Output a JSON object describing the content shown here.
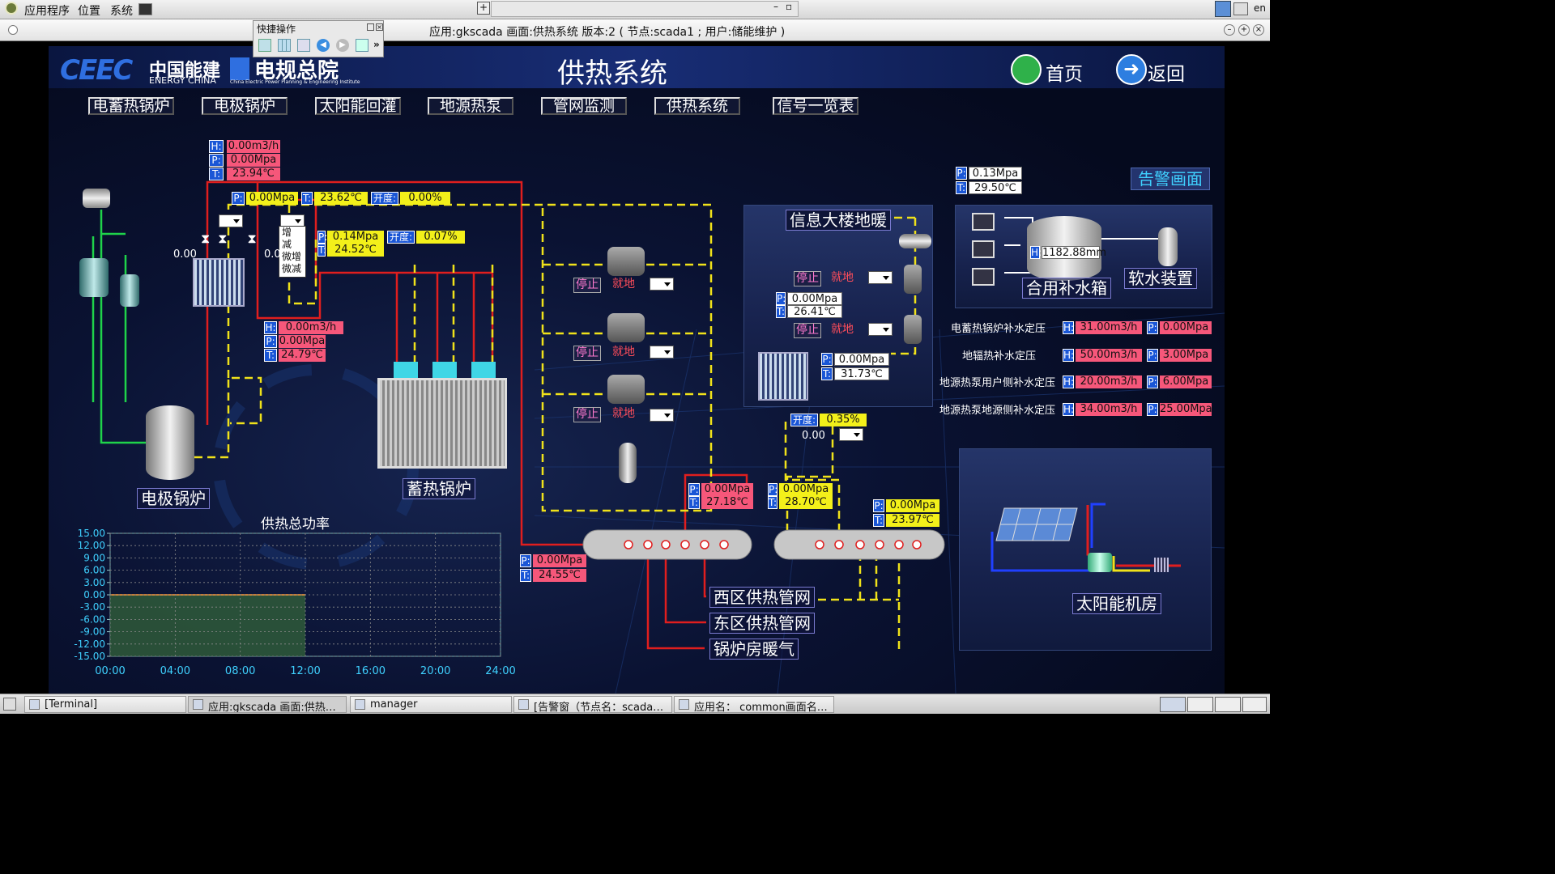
{
  "system_menu": {
    "apps": "应用程序",
    "places": "位置",
    "system": "系统",
    "lang": "en"
  },
  "window": {
    "title": "应用:gkscada  画面:供热系统  版本:2 ( 节点:scada1  ;  用户:储能维护 )"
  },
  "quick_panel": {
    "title": "快捷操作",
    "more": "»"
  },
  "header": {
    "logo_cn": "中国能建",
    "logo_en": "ENERGY CHINA",
    "institute_cn": "电规总院",
    "institute_en": "China Electric Power Planning & Engineering Institute",
    "title": "供热系统",
    "home": "首页",
    "back": "返回"
  },
  "nav": [
    "电蓄热锅炉",
    "电极锅炉",
    "太阳能回灌",
    "地源热泵",
    "管网监测",
    "供热系统",
    "信号一览表"
  ],
  "alarm_btn": "告警画面",
  "tags": {
    "H": "H:",
    "P": "P:",
    "T": "T:",
    "open": "开度:"
  },
  "readings": {
    "g1_h": "0.00m3/h",
    "g1_p": "0.00Mpa",
    "g1_t": "23.94℃",
    "g2_p": "0.00Mpa",
    "g2_t": "23.62℃",
    "g2_open": "0.00%",
    "g3_p": "0.14Mpa",
    "g3_t": "24.52℃",
    "g3_open": "0.07%",
    "g4_h": "0.00m3/h",
    "g4_p": "0.00Mpa",
    "g4_t": "24.79℃",
    "left_val": "0.00",
    "mid_val": "0.0",
    "info_p1": "0.00Mpa",
    "info_t1": "26.41℃",
    "info_p2": "0.00Mpa",
    "info_t2": "31.73℃",
    "open3": "0.35%",
    "open3_val": "0.00",
    "w1_p": "0.00Mpa",
    "w1_t": "27.18℃",
    "e1_p": "0.00Mpa",
    "e1_t": "28.70℃",
    "e2_p": "0.00Mpa",
    "e2_t": "23.97℃",
    "b1_p": "0.00Mpa",
    "b1_t": "24.55℃",
    "tank_p": "0.13Mpa",
    "tank_t": "29.50℃",
    "tank_h": "1182.88mm"
  },
  "dropdown_menu": [
    "增",
    "减",
    "微增",
    "微减"
  ],
  "pumps": [
    {
      "stop": "停止",
      "local": "就地"
    },
    {
      "stop": "停止",
      "local": "就地"
    },
    {
      "stop": "停止",
      "local": "就地"
    }
  ],
  "info_building": {
    "title": "信息大楼地暖",
    "pumps": [
      {
        "stop": "停止",
        "local": "就地"
      },
      {
        "stop": "停止",
        "local": "就地"
      }
    ]
  },
  "water": {
    "tank": "合用补水箱",
    "softener": "软水装置"
  },
  "makeup_rows": [
    {
      "label": "电蓄热锅炉补水定压",
      "h": "31.00m3/h",
      "p": "0.00Mpa"
    },
    {
      "label": "地辐热补水定压",
      "h": "50.00m3/h",
      "p": "3.00Mpa"
    },
    {
      "label": "地源热泵用户侧补水定压",
      "h": "20.00m3/h",
      "p": "6.00Mpa"
    },
    {
      "label": "地源热泵地源侧补水定压",
      "h": "34.00m3/h",
      "p": "25.00Mpa"
    }
  ],
  "equipment": {
    "electrode_boiler": "电极锅炉",
    "storage_boiler": "蓄热锅炉",
    "solar_room": "太阳能机房",
    "west": "西区供热管网",
    "east": "东区供热管网",
    "boiler_room": "锅炉房暖气"
  },
  "chart_data": {
    "type": "area",
    "title": "供热总功率",
    "x": [
      "00:00",
      "04:00",
      "08:00",
      "12:00",
      "16:00",
      "20:00",
      "24:00"
    ],
    "yticks": [
      "15.00",
      "12.00",
      "9.00",
      "6.00",
      "3.00",
      "0.00",
      "-3.00",
      "-6.00",
      "-9.00",
      "-12.00",
      "-15.00"
    ],
    "ylim": [
      -15,
      15
    ],
    "series": [
      {
        "x_start": "00:00",
        "x_end": "12:00",
        "value": 0.0
      }
    ],
    "grid": true
  },
  "taskbar": [
    "[Terminal]",
    "应用:gkscada  画面:供热…",
    "manager",
    "[告警窗（节点名：scada…",
    "应用名： common画面名…"
  ]
}
